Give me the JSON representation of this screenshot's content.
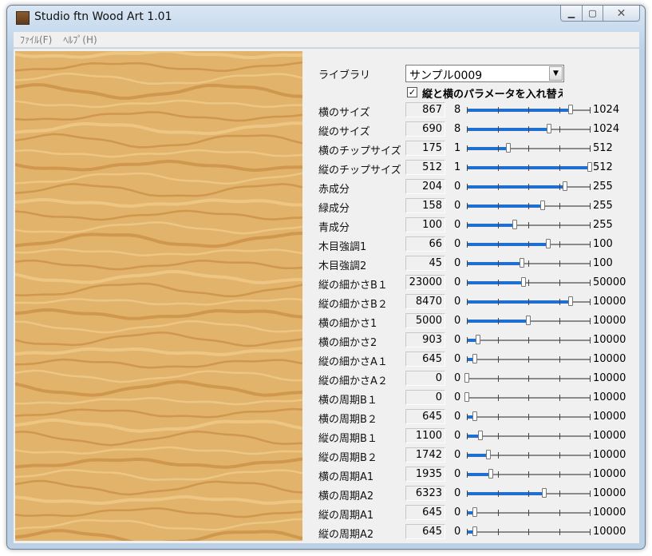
{
  "window": {
    "title": "Studio ftn Wood Art 1.01"
  },
  "menu": [
    {
      "label": "ﾌｧｲﾙ(F)"
    },
    {
      "label": "ﾍﾙﾌﾟ(H)"
    }
  ],
  "library": {
    "label": "ライブラリ",
    "selected": "サンプル0009"
  },
  "swap": {
    "label": "縦と横のパラメータを入れ替え",
    "checked": true
  },
  "params": [
    {
      "label": "横のサイズ",
      "value": 867,
      "min": "8",
      "max": "1024",
      "min_num": 8,
      "max_num": 1024
    },
    {
      "label": "縦のサイズ",
      "value": 690,
      "min": "8",
      "max": "1024",
      "min_num": 8,
      "max_num": 1024
    },
    {
      "label": "横のチップサイズ",
      "value": 175,
      "min": "1",
      "max": "512",
      "min_num": 1,
      "max_num": 512
    },
    {
      "label": "縦のチップサイズ",
      "value": 512,
      "min": "1",
      "max": "512",
      "min_num": 1,
      "max_num": 512
    },
    {
      "label": "赤成分",
      "value": 204,
      "min": "0",
      "max": "255",
      "min_num": 0,
      "max_num": 255
    },
    {
      "label": "緑成分",
      "value": 158,
      "min": "0",
      "max": "255",
      "min_num": 0,
      "max_num": 255
    },
    {
      "label": "青成分",
      "value": 100,
      "min": "0",
      "max": "255",
      "min_num": 0,
      "max_num": 255
    },
    {
      "label": "木目強調1",
      "value": 66,
      "min": "0",
      "max": "100",
      "min_num": 0,
      "max_num": 100
    },
    {
      "label": "木目強調2",
      "value": 45,
      "min": "0",
      "max": "100",
      "min_num": 0,
      "max_num": 100
    },
    {
      "label": "縦の細かさB１",
      "value": 23000,
      "min": "0",
      "max": "50000",
      "min_num": 0,
      "max_num": 50000
    },
    {
      "label": "縦の細かさB２",
      "value": 8470,
      "min": "0",
      "max": "10000",
      "min_num": 0,
      "max_num": 10000
    },
    {
      "label": "横の細かさ1",
      "value": 5000,
      "min": "0",
      "max": "10000",
      "min_num": 0,
      "max_num": 10000
    },
    {
      "label": "横の細かさ2",
      "value": 903,
      "min": "0",
      "max": "10000",
      "min_num": 0,
      "max_num": 10000
    },
    {
      "label": "縦の細かさA１",
      "value": 645,
      "min": "0",
      "max": "10000",
      "min_num": 0,
      "max_num": 10000
    },
    {
      "label": "縦の細かさA２",
      "value": 0,
      "min": "0",
      "max": "10000",
      "min_num": 0,
      "max_num": 10000
    },
    {
      "label": "横の周期B１",
      "value": 0,
      "min": "0",
      "max": "10000",
      "min_num": 0,
      "max_num": 10000
    },
    {
      "label": "横の周期B２",
      "value": 645,
      "min": "0",
      "max": "10000",
      "min_num": 0,
      "max_num": 10000
    },
    {
      "label": "縦の周期B１",
      "value": 1100,
      "min": "0",
      "max": "10000",
      "min_num": 0,
      "max_num": 10000
    },
    {
      "label": "縦の周期B２",
      "value": 1742,
      "min": "0",
      "max": "10000",
      "min_num": 0,
      "max_num": 10000
    },
    {
      "label": "横の周期A1",
      "value": 1935,
      "min": "0",
      "max": "10000",
      "min_num": 0,
      "max_num": 10000
    },
    {
      "label": "横の周期A2",
      "value": 6323,
      "min": "0",
      "max": "10000",
      "min_num": 0,
      "max_num": 10000
    },
    {
      "label": "縦の周期A1",
      "value": 645,
      "min": "0",
      "max": "10000",
      "min_num": 0,
      "max_num": 10000
    },
    {
      "label": "縦の周期A2",
      "value": 645,
      "min": "0",
      "max": "10000",
      "min_num": 0,
      "max_num": 10000
    }
  ],
  "colors": {
    "wood_base": "#e2b36a",
    "grain_light": "#f1cc8c",
    "grain_dark": "#c98e45",
    "slider_fill": "#1e6fd0"
  },
  "icons": {
    "app": "wood-texture-icon",
    "minimize": "minimize-icon",
    "maximize": "maximize-icon",
    "close": "close-icon",
    "dropdown": "chevron-down-icon"
  }
}
